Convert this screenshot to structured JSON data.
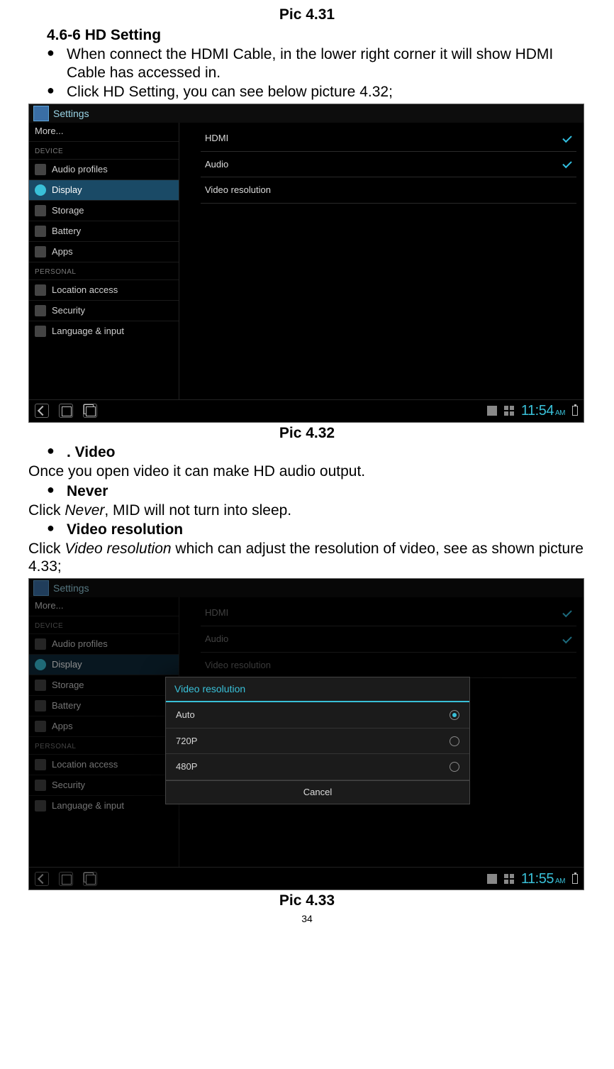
{
  "topCaption": "Pic 4.31",
  "heading": "4.6-6 HD Setting",
  "intro1": "When connect the HDMI Cable, in the lower right corner it will show HDMI Cable has accessed in.",
  "intro2": "Click   HD Setting, you can see below picture 4.32;",
  "cap2": "Pic 4.32",
  "videoH": ". Video",
  "videoP": "Once you open video it can make HD audio output.",
  "neverH": "Never",
  "neverP_a": "Click ",
  "neverP_i": "Never",
  "neverP_b": ", MID will not turn into sleep.",
  "vrH": "Video resolution",
  "vrP_a": "Click ",
  "vrP_i": "Video resolution",
  "vrP_b": " which can adjust the resolution of video, see as shown picture 4.33;",
  "cap3": "Pic 4.33",
  "pageNum": "34",
  "shot": {
    "title": "Settings",
    "more": "More...",
    "deviceHdr": "DEVICE",
    "audioProfiles": "Audio profiles",
    "display": "Display",
    "storage": "Storage",
    "battery": "Battery",
    "apps": "Apps",
    "personalHdr": "PERSONAL",
    "location": "Location access",
    "security": "Security",
    "lang": "Language & input",
    "hdmi": "HDMI",
    "audio": "Audio",
    "videoRes": "Video resolution",
    "clock": "11:54",
    "ampm": "AM"
  },
  "dialog": {
    "title": "Video resolution",
    "opt1": "Auto",
    "opt2": "720P",
    "opt3": "480P",
    "cancel": "Cancel"
  },
  "clock2": "11:55"
}
